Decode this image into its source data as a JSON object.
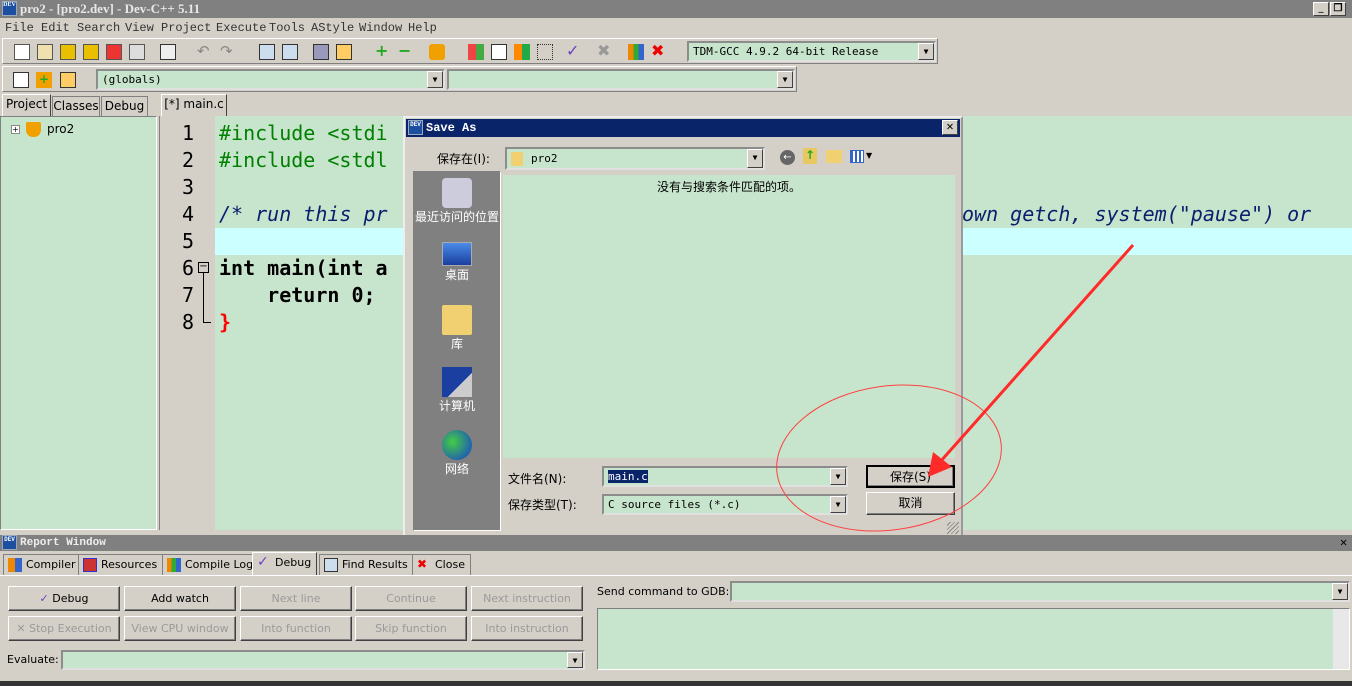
{
  "window": {
    "title": "pro2 - [pro2.dev] - Dev-C++ 5.11",
    "app_icon": "DEV"
  },
  "menu": [
    "File",
    "Edit",
    "Search",
    "View",
    "Project",
    "Execute",
    "Tools",
    "AStyle",
    "Window",
    "Help"
  ],
  "toolbar": {
    "compiler": "TDM-GCC 4.9.2 64-bit Release",
    "scope": "(globals)",
    "member": ""
  },
  "left_tabs": [
    "Project",
    "Classes",
    "Debug"
  ],
  "project_tree": {
    "root": "pro2"
  },
  "editor": {
    "tab": "[*] main.c",
    "line_numbers": [
      "1",
      "2",
      "3",
      "4",
      "5",
      "6",
      "7",
      "8"
    ],
    "visible_left": [
      "#include <stdi",
      "#include <stdl",
      "",
      "/* run this pr",
      "",
      "int main(int a",
      "    return 0;",
      "}"
    ],
    "line4_right": "own getch, system(\"pause\") or",
    "current_line": 5
  },
  "dialog": {
    "title": "Save As",
    "save_in_label": "保存在(I):",
    "save_in_value": "pro2",
    "empty_message": "没有与搜索条件匹配的项。",
    "places": [
      "最近访问的位置",
      "桌面",
      "库",
      "计算机",
      "网络"
    ],
    "filename_label": "文件名(N):",
    "filename_value": "main.c",
    "filetype_label": "保存类型(T):",
    "filetype_value": "C source files (*.c)",
    "save_button": "保存(S)",
    "cancel_button": "取消"
  },
  "report": {
    "title": "Report Window",
    "tabs": [
      "Compiler",
      "Resources",
      "Compile Log",
      "Debug",
      "Find Results",
      "Close"
    ],
    "active_tab": "Debug",
    "buttons_row1": [
      "Debug",
      "Add watch",
      "Next line",
      "Continue",
      "Next instruction"
    ],
    "buttons_row2": [
      "Stop Execution",
      "View CPU window",
      "Into function",
      "Skip function",
      "Into instruction"
    ],
    "evaluate_label": "Evaluate:",
    "evaluate_value": "",
    "gdb_label": "Send command to GDB:",
    "gdb_value": ""
  },
  "colors": {
    "editor_bg": "#c7e5cc",
    "current_line": "#ccffff",
    "dialog_title": "#0a246a",
    "annotation": "#ff2a2a"
  }
}
